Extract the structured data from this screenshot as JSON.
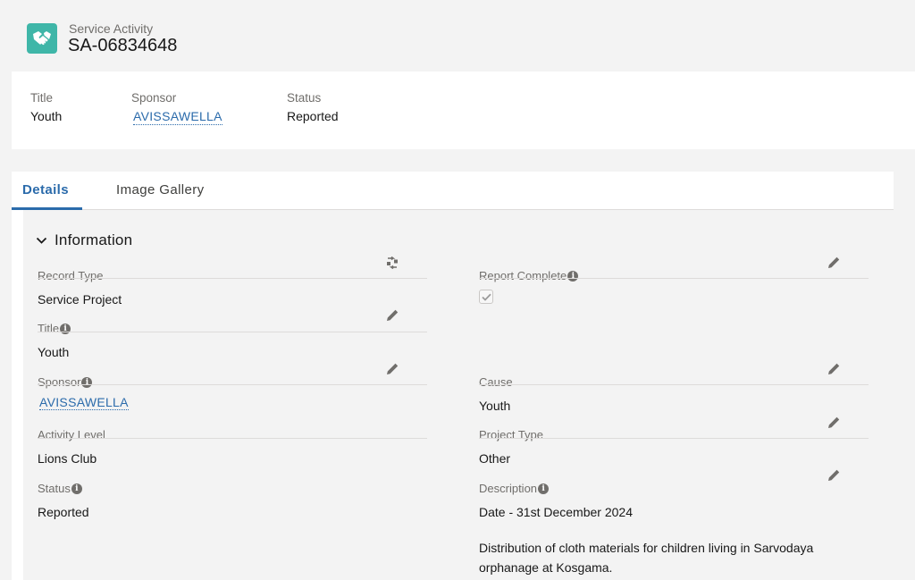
{
  "header": {
    "object_type": "Service Activity",
    "record_name": "SA-06834648"
  },
  "highlights": {
    "fields": [
      {
        "label": "Title",
        "value": "Youth"
      },
      {
        "label": "Sponsor",
        "value": "AVISSAWELLA"
      },
      {
        "label": "Status",
        "value": "Reported"
      }
    ]
  },
  "tabs": [
    {
      "label": "Details",
      "active": true
    },
    {
      "label": "Image Gallery",
      "active": false
    }
  ],
  "section": {
    "title": "Information",
    "fields": {
      "record_type": {
        "label": "Record Type",
        "value": "Service Project"
      },
      "title": {
        "label": "Title",
        "value": "Youth"
      },
      "sponsor": {
        "label": "Sponsor",
        "value": "AVISSAWELLA"
      },
      "activity_level": {
        "label": "Activity Level",
        "value": "Lions Club"
      },
      "status": {
        "label": "Status",
        "value": "Reported"
      },
      "report_complete": {
        "label": "Report Complete",
        "checked": true
      },
      "cause": {
        "label": "Cause",
        "value": "Youth"
      },
      "project_type": {
        "label": "Project Type",
        "value": "Other"
      },
      "description": {
        "label": "Description",
        "line1": "Date - 31st December 2024",
        "line2": "Distribution of cloth materials for children living in Sarvodaya orphanage at Kosgama."
      }
    }
  },
  "icons": {
    "object": "handshake-icon",
    "edit": "pencil-icon",
    "change_type": "swap-icon",
    "info": "info-icon",
    "collapse": "chevron-down-icon"
  },
  "colors": {
    "accent": "#2b6bab",
    "object_icon": "#3fb6a8"
  }
}
